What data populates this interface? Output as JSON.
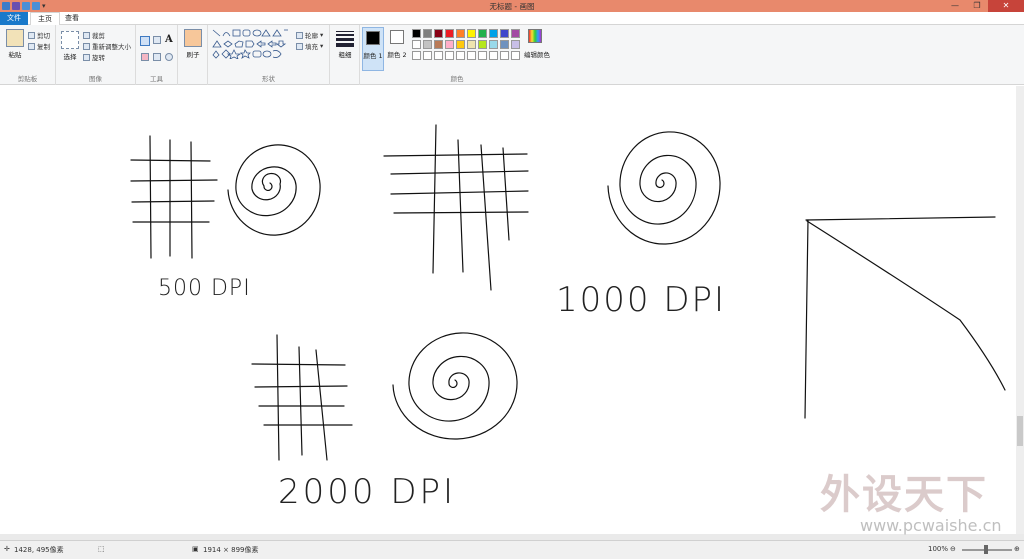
{
  "window": {
    "title": "无标题 - 画图"
  },
  "tabs": {
    "file": "文件",
    "home": "主页",
    "view": "查看"
  },
  "ribbon": {
    "clipboard": {
      "paste": "粘贴",
      "cut": "剪切",
      "copy": "复制",
      "label": "剪贴板"
    },
    "image": {
      "select": "选择",
      "crop": "裁剪",
      "resize": "重新调整大小",
      "rotate": "旋转",
      "label": "图像"
    },
    "tools": {
      "text_glyph": "A",
      "label": "工具"
    },
    "brushes": {
      "label": "刷子"
    },
    "shapes": {
      "outline": "轮廓",
      "fill": "填充",
      "label": "形状"
    },
    "size": {
      "label": "粗细"
    },
    "colors": {
      "color1": "颜色 1",
      "color2": "颜色 2",
      "edit": "编辑颜色",
      "label": "颜色",
      "row1": [
        "#000000",
        "#7f7f7f",
        "#880015",
        "#ed1c24",
        "#ff7f27",
        "#fff200",
        "#22b14c",
        "#00a2e8",
        "#3f48cc",
        "#a349a4"
      ],
      "row2": [
        "#ffffff",
        "#c3c3c3",
        "#b97a57",
        "#ffaec9",
        "#ffc90e",
        "#efe4b0",
        "#b5e61d",
        "#99d9ea",
        "#7092be",
        "#c8bfe7"
      ]
    }
  },
  "canvas": {
    "labels": {
      "dpi500": "500 DPI",
      "dpi1000": "1000 DPI",
      "dpi2000": "2000 DPI"
    }
  },
  "status": {
    "cursor": "1428, 495像素",
    "size": "1914 × 899像素",
    "zoom": "100%"
  },
  "watermark": {
    "cn": "外设天下",
    "url": "www.pcwaishe.cn"
  }
}
